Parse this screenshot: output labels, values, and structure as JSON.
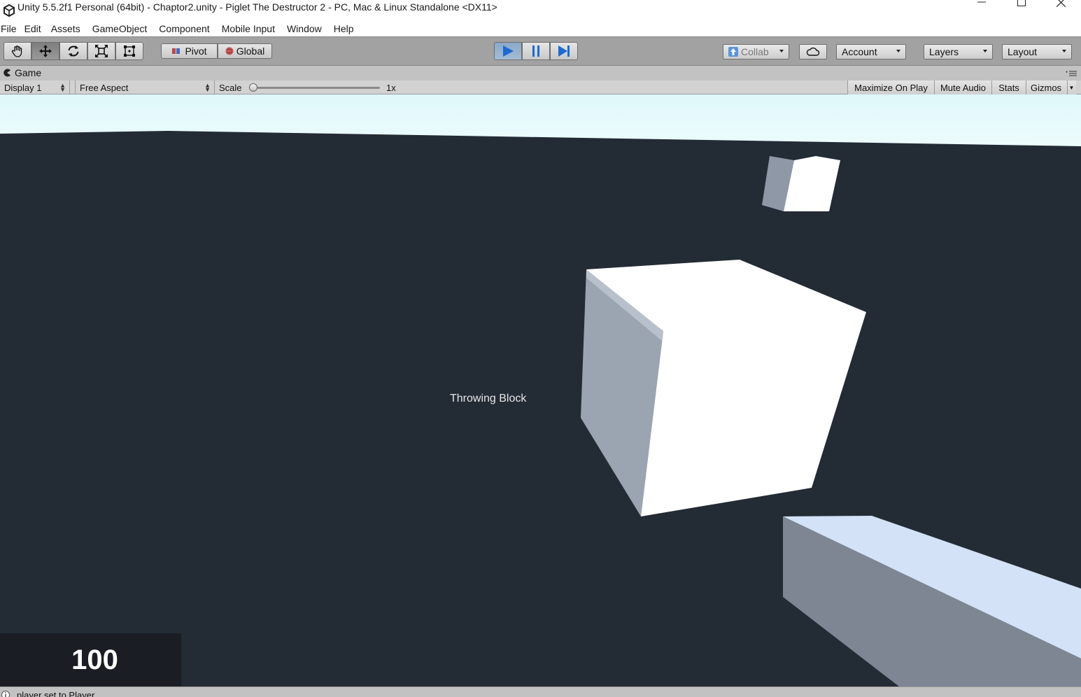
{
  "window": {
    "title": "Unity 5.5.2f1 Personal (64bit) - Chaptor2.unity - Piglet The Destructor 2 - PC, Mac & Linux Standalone <DX11>",
    "controls": [
      "minimize-icon",
      "maximize-icon",
      "close-icon"
    ]
  },
  "menu": {
    "items": [
      "File",
      "Edit",
      "Assets",
      "GameObject",
      "Component",
      "Mobile Input",
      "Window",
      "Help"
    ]
  },
  "toolbar": {
    "transform_tools": [
      "hand-icon",
      "move-icon",
      "rotate-icon",
      "scale-icon",
      "rect-tool-icon"
    ],
    "active_tool": "move-icon",
    "pivot_label": "Pivot",
    "global_label": "Global",
    "playback": {
      "play_active": true,
      "icons": [
        "play-icon",
        "pause-icon",
        "step-icon"
      ]
    },
    "collab_label": "Collab",
    "account_label": "Account",
    "layers_label": "Layers",
    "layout_label": "Layout"
  },
  "game_view": {
    "tab_label": "Game",
    "display_label": "Display 1",
    "aspect_label": "Free Aspect",
    "scale_label": "Scale",
    "scale_value": "1x",
    "maximize_label": "Maximize On Play",
    "mute_label": "Mute Audio",
    "stats_label": "Stats",
    "gizmos_label": "Gizmos"
  },
  "scene": {
    "label_text": "Throwing Block",
    "score": "100",
    "colors": {
      "sky": "#e6fbfc",
      "ground": "#232b35",
      "cube_light": "#ffffff",
      "cube_shadow": "#9aa3b0",
      "beam_top": "#d2e2f6",
      "beam_side": "#7e8694"
    }
  },
  "status": {
    "message": "player set to Player"
  }
}
